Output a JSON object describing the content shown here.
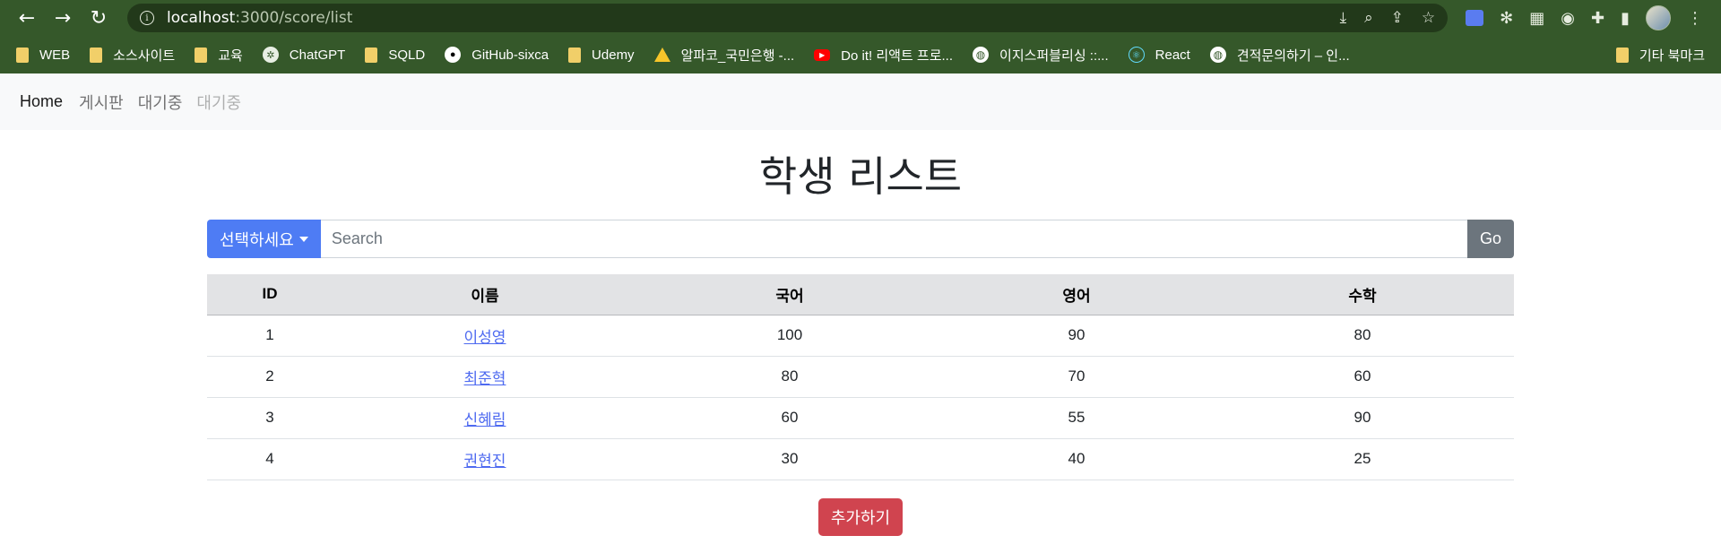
{
  "browser": {
    "url_host": "localhost",
    "url_path": ":3000/score/list",
    "bookmarks": [
      {
        "label": "WEB",
        "icon": "folder-icon"
      },
      {
        "label": "소스사이트",
        "icon": "folder-icon"
      },
      {
        "label": "교육",
        "icon": "folder-icon"
      },
      {
        "label": "ChatGPT",
        "icon": "chatgpt-icon"
      },
      {
        "label": "SQLD",
        "icon": "folder-icon"
      },
      {
        "label": "GitHub-sixca",
        "icon": "github-icon"
      },
      {
        "label": "Udemy",
        "icon": "folder-icon"
      },
      {
        "label": "알파코_국민은행 -...",
        "icon": "google-drive-icon"
      },
      {
        "label": "Do it! 리액트 프로...",
        "icon": "youtube-icon"
      },
      {
        "label": "이지스퍼블리싱 ::...",
        "icon": "globe-icon"
      },
      {
        "label": "React",
        "icon": "react-icon"
      },
      {
        "label": "견적문의하기 – 인...",
        "icon": "globe-icon"
      }
    ],
    "other_bookmarks": "기타 북마크"
  },
  "navbar": {
    "brand": "Home",
    "links": [
      "게시판",
      "대기중",
      "대기중"
    ]
  },
  "page": {
    "title": "학생 리스트",
    "dropdown_label": "선택하세요",
    "search_placeholder": "Search",
    "go_label": "Go",
    "add_label": "추가하기"
  },
  "table": {
    "headers": [
      "ID",
      "이름",
      "국어",
      "영어",
      "수학"
    ],
    "rows": [
      {
        "id": "1",
        "name": "이성영",
        "korean": "100",
        "english": "90",
        "math": "80"
      },
      {
        "id": "2",
        "name": "최준혁",
        "korean": "80",
        "english": "70",
        "math": "60"
      },
      {
        "id": "3",
        "name": "신혜림",
        "korean": "60",
        "english": "55",
        "math": "90"
      },
      {
        "id": "4",
        "name": "권현진",
        "korean": "30",
        "english": "40",
        "math": "25"
      }
    ]
  },
  "colors": {
    "chrome": "#35582a",
    "primary": "#4e7cf4",
    "secondary": "#6c757d",
    "danger": "#d0444f",
    "link": "#4e6af0"
  }
}
